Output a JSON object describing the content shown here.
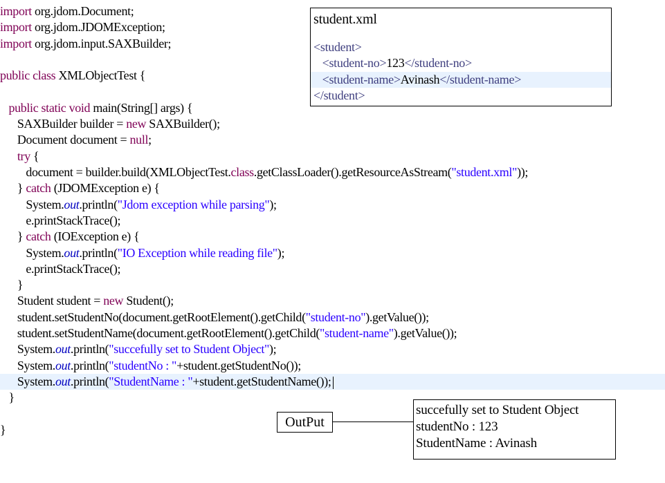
{
  "code": {
    "lines": [
      [
        {
          "t": "import",
          "c": "kw"
        },
        {
          "t": " org.jdom.Document;"
        }
      ],
      [
        {
          "t": "import",
          "c": "kw"
        },
        {
          "t": " org.jdom.JDOMException;"
        }
      ],
      [
        {
          "t": "import",
          "c": "kw"
        },
        {
          "t": " org.jdom.input.SAXBuilder;"
        }
      ],
      [],
      [
        {
          "t": "public",
          "c": "kw"
        },
        {
          "t": " "
        },
        {
          "t": "class",
          "c": "kw"
        },
        {
          "t": " XMLObjectTest {"
        }
      ],
      [],
      [
        {
          "t": "   "
        },
        {
          "t": "public",
          "c": "kw"
        },
        {
          "t": " "
        },
        {
          "t": "static",
          "c": "kw"
        },
        {
          "t": " "
        },
        {
          "t": "void",
          "c": "kw"
        },
        {
          "t": " main(String[] args) {"
        }
      ],
      [
        {
          "t": "      SAXBuilder builder = "
        },
        {
          "t": "new",
          "c": "kw"
        },
        {
          "t": " SAXBuilder();"
        }
      ],
      [
        {
          "t": "      Document document = "
        },
        {
          "t": "null",
          "c": "kw"
        },
        {
          "t": ";"
        }
      ],
      [
        {
          "t": "      "
        },
        {
          "t": "try",
          "c": "kw"
        },
        {
          "t": " {"
        }
      ],
      [
        {
          "t": "         document = builder.build(XMLObjectTest."
        },
        {
          "t": "class",
          "c": "kw"
        },
        {
          "t": ".getClassLoader().getResourceAsStream("
        },
        {
          "t": "\"student.xml\"",
          "c": "str"
        },
        {
          "t": "));"
        }
      ],
      [
        {
          "t": "      } "
        },
        {
          "t": "catch",
          "c": "kw"
        },
        {
          "t": " (JDOMException e) {"
        }
      ],
      [
        {
          "t": "         System."
        },
        {
          "t": "out",
          "c": "fld"
        },
        {
          "t": ".println("
        },
        {
          "t": "\"Jdom exception while parsing\"",
          "c": "str"
        },
        {
          "t": ");"
        }
      ],
      [
        {
          "t": "         e.printStackTrace();"
        }
      ],
      [
        {
          "t": "      } "
        },
        {
          "t": "catch",
          "c": "kw"
        },
        {
          "t": " (IOException e) {"
        }
      ],
      [
        {
          "t": "         System."
        },
        {
          "t": "out",
          "c": "fld"
        },
        {
          "t": ".println("
        },
        {
          "t": "\"IO Exception while reading file\"",
          "c": "str"
        },
        {
          "t": ");"
        }
      ],
      [
        {
          "t": "         e.printStackTrace();"
        }
      ],
      [
        {
          "t": "      }"
        }
      ],
      [
        {
          "t": "      Student student = "
        },
        {
          "t": "new",
          "c": "kw"
        },
        {
          "t": " Student();"
        }
      ],
      [
        {
          "t": "      student.setStudentNo(document.getRootElement().getChild("
        },
        {
          "t": "\"student-no\"",
          "c": "str"
        },
        {
          "t": ").getValue());"
        }
      ],
      [
        {
          "t": "      student.setStudentName(document.getRootElement().getChild("
        },
        {
          "t": "\"student-name\"",
          "c": "str"
        },
        {
          "t": ").getValue());"
        }
      ],
      [
        {
          "t": "      System."
        },
        {
          "t": "out",
          "c": "fld"
        },
        {
          "t": ".println("
        },
        {
          "t": "\"succefully set to Student Object\"",
          "c": "str"
        },
        {
          "t": ");"
        }
      ],
      [
        {
          "t": "      System."
        },
        {
          "t": "out",
          "c": "fld"
        },
        {
          "t": ".println("
        },
        {
          "t": "\"studentNo : \"",
          "c": "str"
        },
        {
          "t": "+student.getStudentNo());"
        }
      ],
      [
        {
          "t": "      System."
        },
        {
          "t": "out",
          "c": "fld"
        },
        {
          "t": ".println("
        },
        {
          "t": "\"StudentName : \"",
          "c": "str"
        },
        {
          "t": "+student.getStudentName());"
        }
      ],
      [
        {
          "t": "   }"
        }
      ],
      [],
      [
        {
          "t": "}"
        }
      ]
    ],
    "highlighted_line": 23
  },
  "xml_panel": {
    "title": "student.xml",
    "lines": [
      [
        {
          "t": "<",
          "c": "tag"
        },
        {
          "t": "student",
          "c": "tagname"
        },
        {
          "t": ">",
          "c": "tag"
        }
      ],
      [
        {
          "t": "   "
        },
        {
          "t": "<",
          "c": "tag"
        },
        {
          "t": "student-no",
          "c": "tagname"
        },
        {
          "t": ">",
          "c": "tag"
        },
        {
          "t": "123",
          "c": "txt"
        },
        {
          "t": "</",
          "c": "tag"
        },
        {
          "t": "student-no",
          "c": "tagname"
        },
        {
          "t": ">",
          "c": "tag"
        }
      ],
      [
        {
          "t": "   "
        },
        {
          "t": "<",
          "c": "tag"
        },
        {
          "t": "student-name",
          "c": "tagname"
        },
        {
          "t": ">",
          "c": "tag"
        },
        {
          "t": "Avinash",
          "c": "txt"
        },
        {
          "t": "</",
          "c": "tag"
        },
        {
          "t": "student-name",
          "c": "tagname"
        },
        {
          "t": ">",
          "c": "tag"
        }
      ],
      [
        {
          "t": "</",
          "c": "tag"
        },
        {
          "t": "student",
          "c": "tagname"
        },
        {
          "t": ">",
          "c": "tag"
        }
      ]
    ],
    "highlighted_line": 2
  },
  "output": {
    "label": "OutPut",
    "lines": [
      "succefully set to Student Object",
      "studentNo : 123",
      "StudentName : Avinash"
    ]
  },
  "colors": {
    "keyword": "#7f0055",
    "string": "#2a00ff",
    "field": "#0000c0",
    "current_line": "#e8f2fe"
  }
}
